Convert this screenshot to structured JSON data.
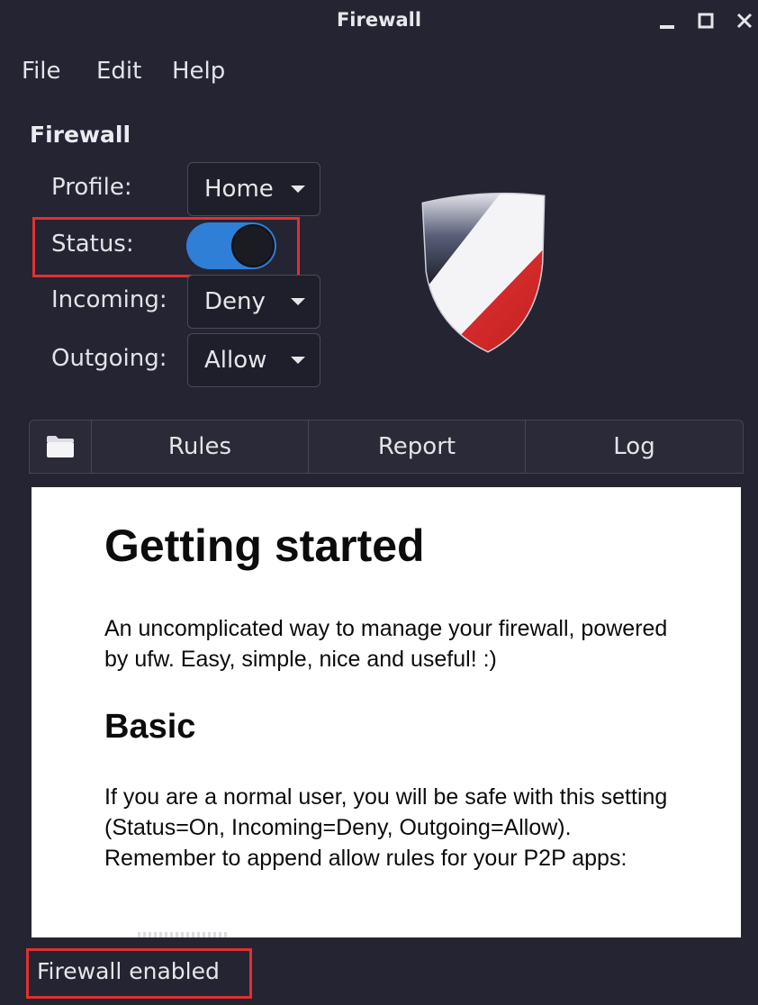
{
  "window": {
    "title": "Firewall"
  },
  "menu": {
    "file": "File",
    "edit": "Edit",
    "help": "Help"
  },
  "settings": {
    "section_title": "Firewall",
    "profile": {
      "label": "Profile:",
      "value": "Home"
    },
    "status": {
      "label": "Status:",
      "enabled": true
    },
    "incoming": {
      "label": "Incoming:",
      "value": "Deny"
    },
    "outgoing": {
      "label": "Outgoing:",
      "value": "Allow"
    }
  },
  "tabs": {
    "rules": "Rules",
    "report": "Report",
    "log": "Log"
  },
  "help": {
    "heading": "Getting started",
    "intro": "An uncomplicated way to manage your firewall, powered by ufw. Easy, simple, nice and useful! :)",
    "subheading": "Basic",
    "body": "If you are a normal user, you will be safe with this setting (Status=On, Incoming=Deny, Outgoing=Allow). Remember to append allow rules for your P2P apps:"
  },
  "statusbar": {
    "text": "Firewall enabled"
  },
  "colors": {
    "background": "#242433",
    "toggle_on": "#2f7fd6",
    "highlight": "#e03131",
    "shield_red": "#d62a2a"
  }
}
